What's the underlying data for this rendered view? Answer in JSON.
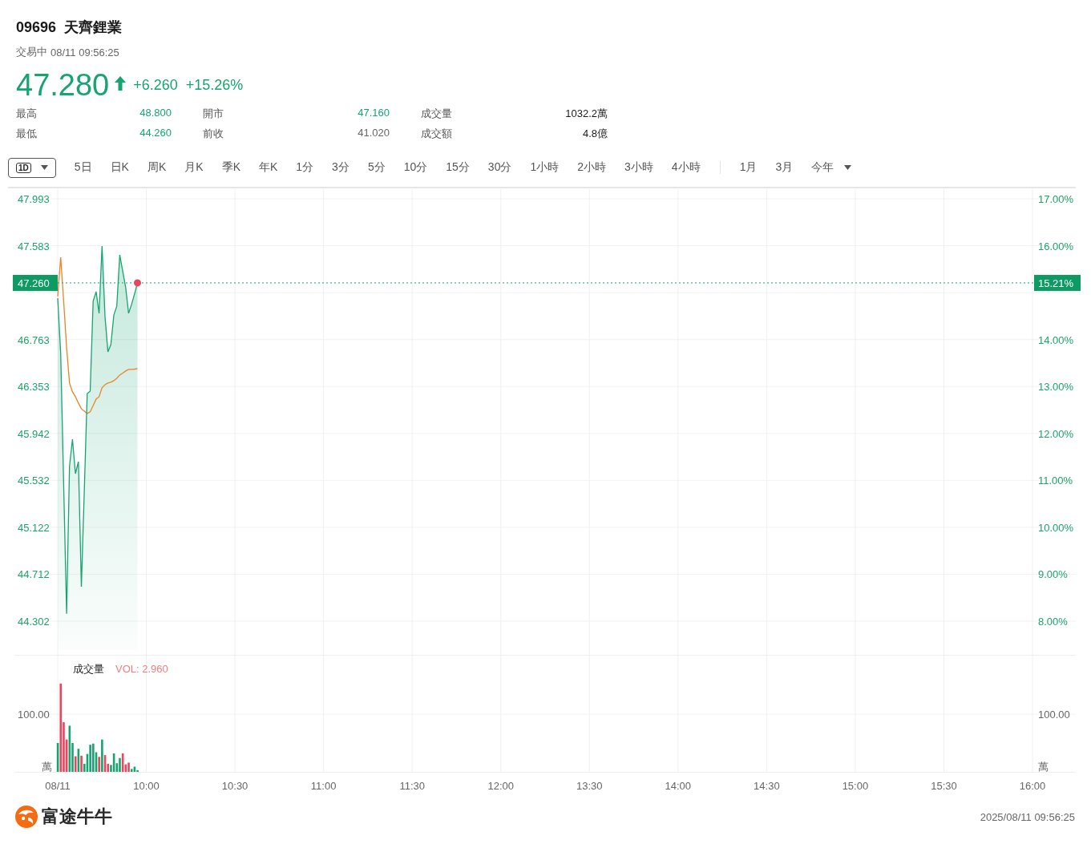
{
  "header": {
    "code": "09696",
    "name": "天齊鋰業",
    "status": "交易中",
    "time": "08/11 09:56:25"
  },
  "quote": {
    "price": "47.280",
    "change": "+6.260",
    "change_percent": "+15.26%"
  },
  "stats": [
    {
      "label": "最高",
      "value": "48.800",
      "color": "#16a571"
    },
    {
      "label": "開市",
      "value": "47.160",
      "color": "#16a571"
    },
    {
      "label": "成交量",
      "value": "1032.2萬",
      "color": "#1a1a1a"
    },
    {
      "label": "最低",
      "value": "44.260",
      "color": "#16a571"
    },
    {
      "label": "前收",
      "value": "41.020",
      "color": "#666666"
    },
    {
      "label": "成交額",
      "value": "4.8億",
      "color": "#1a1a1a"
    }
  ],
  "period_tabs": [
    {
      "label": "1D",
      "kind": "dropdown",
      "selected": true
    },
    {
      "label": "5日",
      "kind": "tab",
      "selected": false
    },
    {
      "label": "日K",
      "kind": "tab",
      "selected": false
    },
    {
      "label": "周K",
      "kind": "tab",
      "selected": false
    },
    {
      "label": "月K",
      "kind": "tab",
      "selected": false
    },
    {
      "label": "季K",
      "kind": "tab",
      "selected": false
    },
    {
      "label": "年K",
      "kind": "tab",
      "selected": false
    },
    {
      "label": "1分",
      "kind": "tab",
      "selected": false
    },
    {
      "label": "3分",
      "kind": "tab",
      "selected": false
    },
    {
      "label": "5分",
      "kind": "tab",
      "selected": false
    },
    {
      "label": "10分",
      "kind": "tab",
      "selected": false
    },
    {
      "label": "15分",
      "kind": "tab",
      "selected": false
    },
    {
      "label": "30分",
      "kind": "tab",
      "selected": false
    },
    {
      "label": "1小時",
      "kind": "tab",
      "selected": false
    },
    {
      "label": "2小時",
      "kind": "tab",
      "selected": false
    },
    {
      "label": "3小時",
      "kind": "tab",
      "selected": false
    },
    {
      "label": "4小時",
      "kind": "tab",
      "selected": false
    }
  ],
  "range_tabs": [
    {
      "label": "1月",
      "kind": "tab",
      "selected": false
    },
    {
      "label": "3月",
      "kind": "tab",
      "selected": false
    },
    {
      "label": "今年",
      "kind": "dropdown",
      "selected": false
    }
  ],
  "price_chart": {
    "price_tag": "47.260",
    "percent_tag": "15.21%",
    "left_axis_labels": [
      "47.993",
      "47.583",
      "46.763",
      "46.353",
      "45.942",
      "45.532",
      "45.122",
      "44.712",
      "44.302"
    ],
    "right_axis_labels": [
      "17.00%",
      "16.00%",
      "14.00%",
      "13.00%",
      "12.00%",
      "11.00%",
      "10.00%",
      "9.00%",
      "8.00%"
    ]
  },
  "volume_chart": {
    "title": "成交量",
    "reading": "VOL: 2.960",
    "left_tick_label": "100.00",
    "right_tick_label": "100.00",
    "left_unit": "萬",
    "right_unit": "萬",
    "time_axis_labels": [
      "08/11",
      "10:00",
      "10:30",
      "11:00",
      "11:30",
      "12:00",
      "13:30",
      "14:00",
      "14:30",
      "15:00",
      "15:30",
      "16:00"
    ]
  },
  "footer": {
    "brand": "富途牛牛",
    "timestamp": "2025/08/11 09:56:25"
  }
}
